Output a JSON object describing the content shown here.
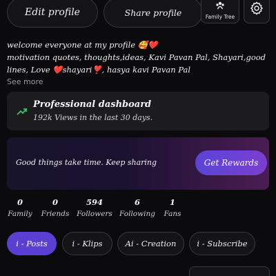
{
  "header": {
    "edit_profile": "Edit profile",
    "share_profile": "Share profile",
    "family_tree": "Family Tree"
  },
  "bio": {
    "line1": "welcome everyone at my profile 🥰❤️",
    "line2": "motivation quotes, thoughts,ideas, Kavi Pavan Pal, Shayari,good lines, Love ❤️shayari❣️, hasya kavi Pavan Pal",
    "see_more": "See more"
  },
  "dashboard": {
    "title": "Professional dashboard",
    "subtitle": "192k Views in the last 30 days."
  },
  "rewards": {
    "message": "Good things take time. Keep sharing",
    "button": "Get Rewards"
  },
  "stats": [
    {
      "value": "0",
      "label": "Family"
    },
    {
      "value": "0",
      "label": "Friends"
    },
    {
      "value": "594",
      "label": "Followers"
    },
    {
      "value": "6",
      "label": "Following"
    },
    {
      "value": "1",
      "label": "Fans"
    }
  ],
  "tabs": [
    {
      "label": "i - Posts",
      "active": true
    },
    {
      "label": "i - Klips",
      "active": false
    },
    {
      "label": "Ai - Creation",
      "active": false
    },
    {
      "label": "i - Subscribe",
      "active": false
    }
  ],
  "colors": {
    "background": "#0b0b0d",
    "accent": "#5a3fd3",
    "trend_green": "#3fbf6a"
  },
  "icons": {
    "family_tree": "family-tree-icon",
    "settings": "gear-icon",
    "trend": "trending-up-icon"
  }
}
